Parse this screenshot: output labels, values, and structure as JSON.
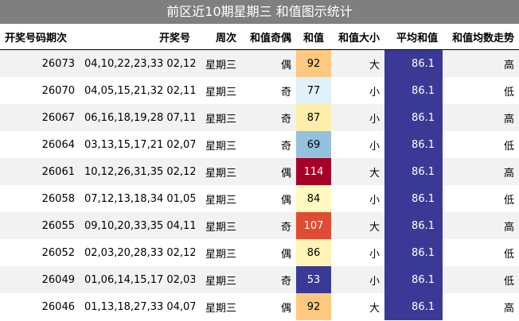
{
  "title": "前区近10期星期三 和值图示统计",
  "headers": [
    "开奖号码期次",
    "开奖号",
    "周次",
    "和值奇偶",
    "和值",
    "和值大小",
    "平均和值",
    "和值均数走势"
  ],
  "rows": [
    {
      "issue": "26073",
      "numbers": "04,10,22,23,33 02,12",
      "weekday": "星期三",
      "parity": "偶",
      "sum": "92",
      "size": "大",
      "avg": "86.1",
      "trend": "高",
      "sum_color": "#fdc980",
      "sum_text_color": "#000000"
    },
    {
      "issue": "26070",
      "numbers": "04,05,15,21,32 02,11",
      "weekday": "星期三",
      "parity": "奇",
      "sum": "77",
      "size": "小",
      "avg": "86.1",
      "trend": "低",
      "sum_color": "#dff1f9",
      "sum_text_color": "#000000"
    },
    {
      "issue": "26067",
      "numbers": "06,16,18,19,28 07,11",
      "weekday": "星期三",
      "parity": "奇",
      "sum": "87",
      "size": "小",
      "avg": "86.1",
      "trend": "高",
      "sum_color": "#fdeeaa",
      "sum_text_color": "#000000"
    },
    {
      "issue": "26064",
      "numbers": "03,13,15,17,21 02,07",
      "weekday": "星期三",
      "parity": "奇",
      "sum": "69",
      "size": "小",
      "avg": "86.1",
      "trend": "低",
      "sum_color": "#93c2de",
      "sum_text_color": "#000000"
    },
    {
      "issue": "26061",
      "numbers": "10,12,26,31,35 02,12",
      "weekday": "星期三",
      "parity": "偶",
      "sum": "114",
      "size": "大",
      "avg": "86.1",
      "trend": "高",
      "sum_color": "#a50026",
      "sum_text_color": "#ffffff"
    },
    {
      "issue": "26058",
      "numbers": "07,12,13,18,34 01,05",
      "weekday": "星期三",
      "parity": "偶",
      "sum": "84",
      "size": "小",
      "avg": "86.1",
      "trend": "低",
      "sum_color": "#fffbc0",
      "sum_text_color": "#000000"
    },
    {
      "issue": "26055",
      "numbers": "09,10,20,33,35 04,11",
      "weekday": "星期三",
      "parity": "奇",
      "sum": "107",
      "size": "大",
      "avg": "86.1",
      "trend": "高",
      "sum_color": "#e04b33",
      "sum_text_color": "#ffffff"
    },
    {
      "issue": "26052",
      "numbers": "02,03,20,28,33 02,12",
      "weekday": "星期三",
      "parity": "偶",
      "sum": "86",
      "size": "小",
      "avg": "86.1",
      "trend": "低",
      "sum_color": "#fff4b3",
      "sum_text_color": "#000000"
    },
    {
      "issue": "26049",
      "numbers": "01,06,14,15,17 02,03",
      "weekday": "星期三",
      "parity": "奇",
      "sum": "53",
      "size": "小",
      "avg": "86.1",
      "trend": "低",
      "sum_color": "#3a3a96",
      "sum_text_color": "#ffffff"
    },
    {
      "issue": "26046",
      "numbers": "01,13,18,27,33 04,07",
      "weekday": "星期三",
      "parity": "偶",
      "sum": "92",
      "size": "大",
      "avg": "86.1",
      "trend": "高",
      "sum_color": "#fdc980",
      "sum_text_color": "#000000"
    }
  ]
}
